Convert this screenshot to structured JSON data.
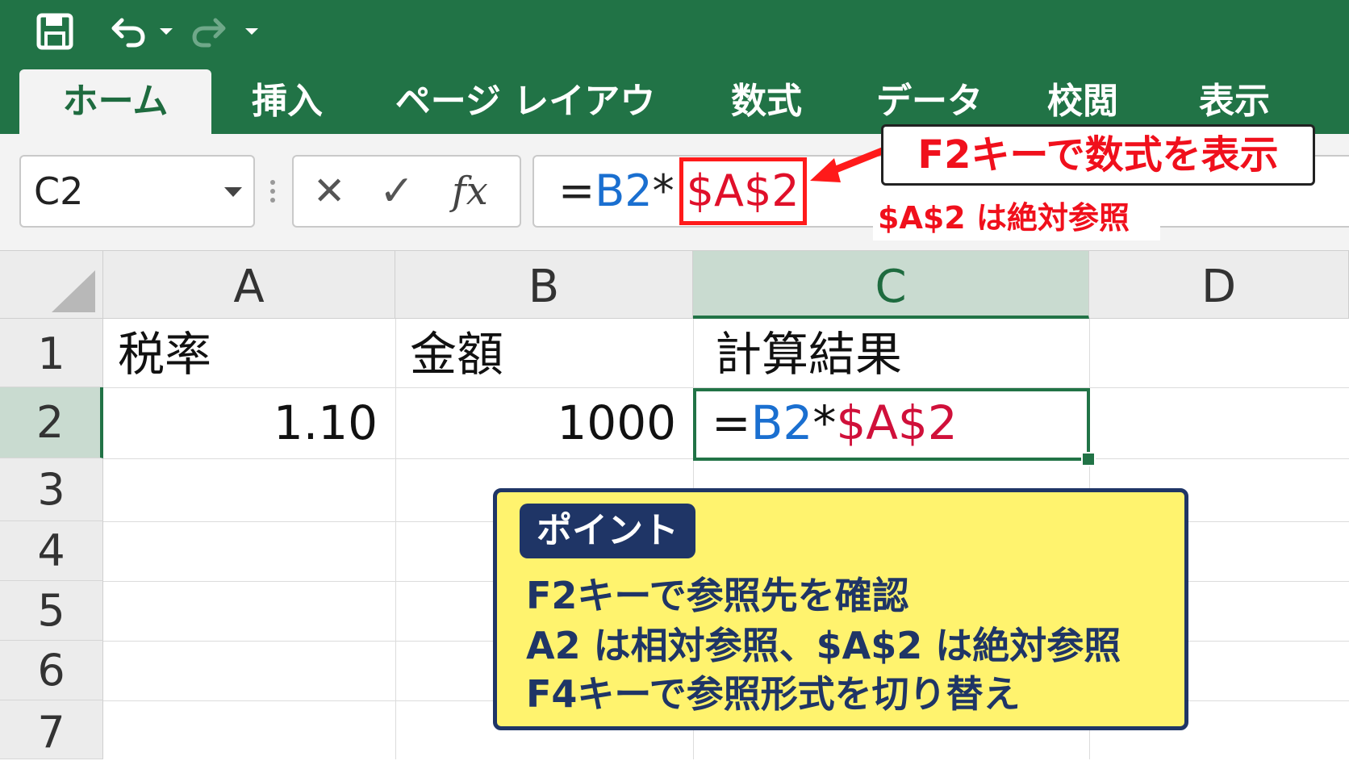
{
  "ribbon": {
    "tabs": [
      {
        "label": "ホーム",
        "active": true
      },
      {
        "label": "挿入"
      },
      {
        "label": "ページ レイアウト"
      },
      {
        "label": "数式"
      },
      {
        "label": "データ"
      },
      {
        "label": "校閲"
      },
      {
        "label": "表示"
      }
    ],
    "quick_access_icons": [
      "save-icon",
      "undo-icon",
      "chevron-down-icon",
      "redo-icon",
      "chevron-down-icon"
    ]
  },
  "formula_bar": {
    "name_box": "C2",
    "cancel_glyph": "✕",
    "enter_glyph": "✓",
    "function_glyph": "fx",
    "formula_prefix": "=",
    "formula_rel": "B2",
    "formula_op": "*",
    "formula_abs": "$A$2"
  },
  "callout": {
    "main": "F2キーで数式を表示",
    "sub": "$A$2 は絶対参照"
  },
  "grid": {
    "columns": [
      "A",
      "B",
      "C",
      "D"
    ],
    "rows": [
      "1",
      "2",
      "3",
      "4",
      "5",
      "6",
      "7"
    ],
    "selected_column": "C",
    "selected_row": "2",
    "cells": {
      "A1": "税率",
      "B1": "金額",
      "C1": "計算結果",
      "A2": "1.10",
      "B2": "1000",
      "C2_prefix": "=",
      "C2_rel": "B2",
      "C2_op": "*",
      "C2_abs": "$A$2"
    }
  },
  "point": {
    "badge": "ポイント",
    "lines": [
      "F2キーで参照先を確認",
      "A2 は相対参照、$A$2 は絶対参照",
      "F4キーで参照形式を切り替え"
    ]
  },
  "colors": {
    "ribbon_green": "#217346",
    "relative_ref": "#1a6fd0",
    "absolute_ref": "#d0103a",
    "highlight_red": "#ff1a1a",
    "point_bg": "#fff36e",
    "point_navy": "#1f3566"
  }
}
